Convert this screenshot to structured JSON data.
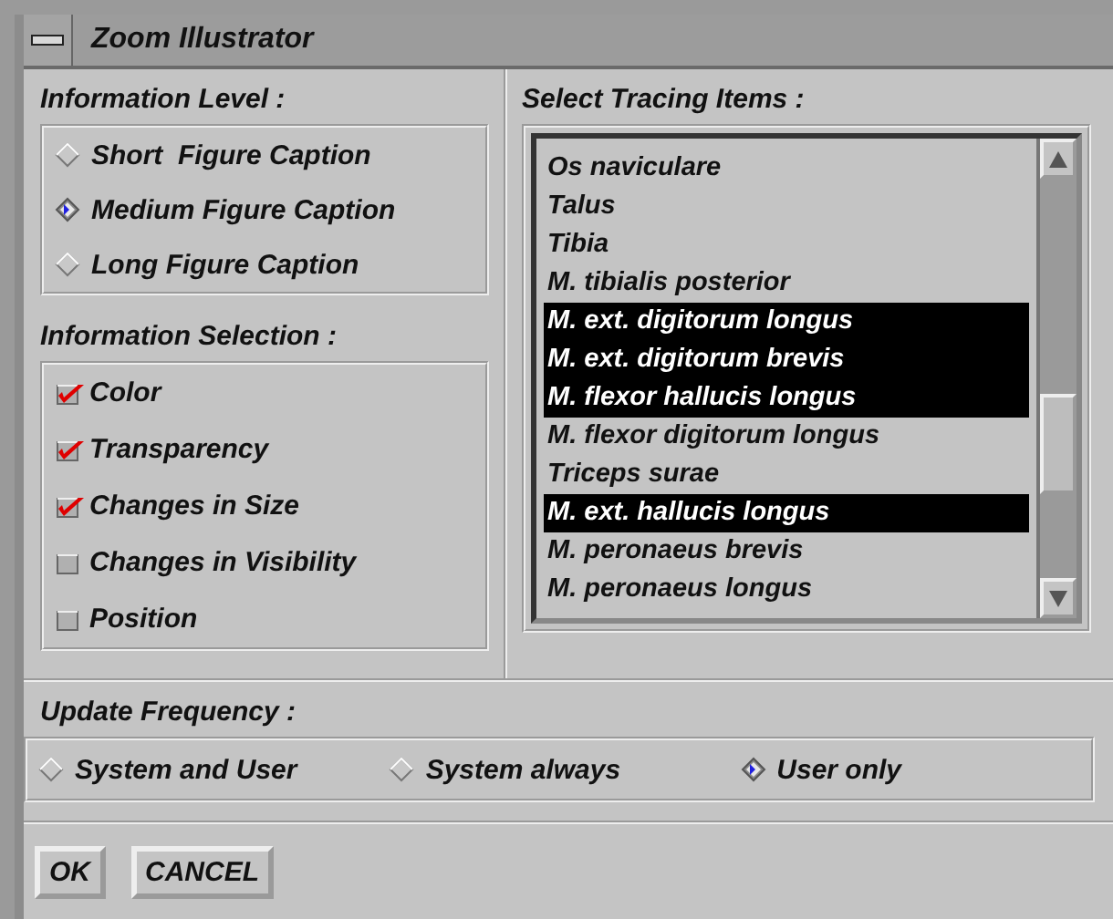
{
  "window": {
    "title": "Zoom Illustrator"
  },
  "information_level": {
    "label": "Information Level :",
    "options": [
      {
        "label": "Short  Figure Caption",
        "selected": false
      },
      {
        "label": "Medium Figure Caption",
        "selected": true
      },
      {
        "label": "Long Figure Caption",
        "selected": false
      }
    ]
  },
  "information_selection": {
    "label": "Information Selection :",
    "options": [
      {
        "label": "Color",
        "checked": true
      },
      {
        "label": "Transparency",
        "checked": true
      },
      {
        "label": "Changes in Size",
        "checked": true
      },
      {
        "label": "Changes in Visibility",
        "checked": false
      },
      {
        "label": "Position",
        "checked": false
      }
    ]
  },
  "tracing_items": {
    "label": "Select Tracing Items :",
    "items": [
      {
        "label": "Os naviculare",
        "selected": false
      },
      {
        "label": "Talus",
        "selected": false
      },
      {
        "label": "Tibia",
        "selected": false
      },
      {
        "label": "M. tibialis posterior",
        "selected": false
      },
      {
        "label": "M. ext. digitorum longus",
        "selected": true
      },
      {
        "label": "M. ext. digitorum brevis",
        "selected": true
      },
      {
        "label": "M. flexor hallucis longus",
        "selected": true
      },
      {
        "label": "M. flexor digitorum longus",
        "selected": false
      },
      {
        "label": "Triceps surae",
        "selected": false
      },
      {
        "label": "M. ext. hallucis longus",
        "selected": true
      },
      {
        "label": "M. peronaeus brevis",
        "selected": false
      },
      {
        "label": "M. peronaeus longus",
        "selected": false
      }
    ]
  },
  "update_frequency": {
    "label": "Update Frequency :",
    "options": [
      {
        "label": "System and User",
        "selected": false
      },
      {
        "label": "System always",
        "selected": false
      },
      {
        "label": "User only",
        "selected": true
      }
    ]
  },
  "buttons": [
    "OK",
    "CANCEL"
  ]
}
